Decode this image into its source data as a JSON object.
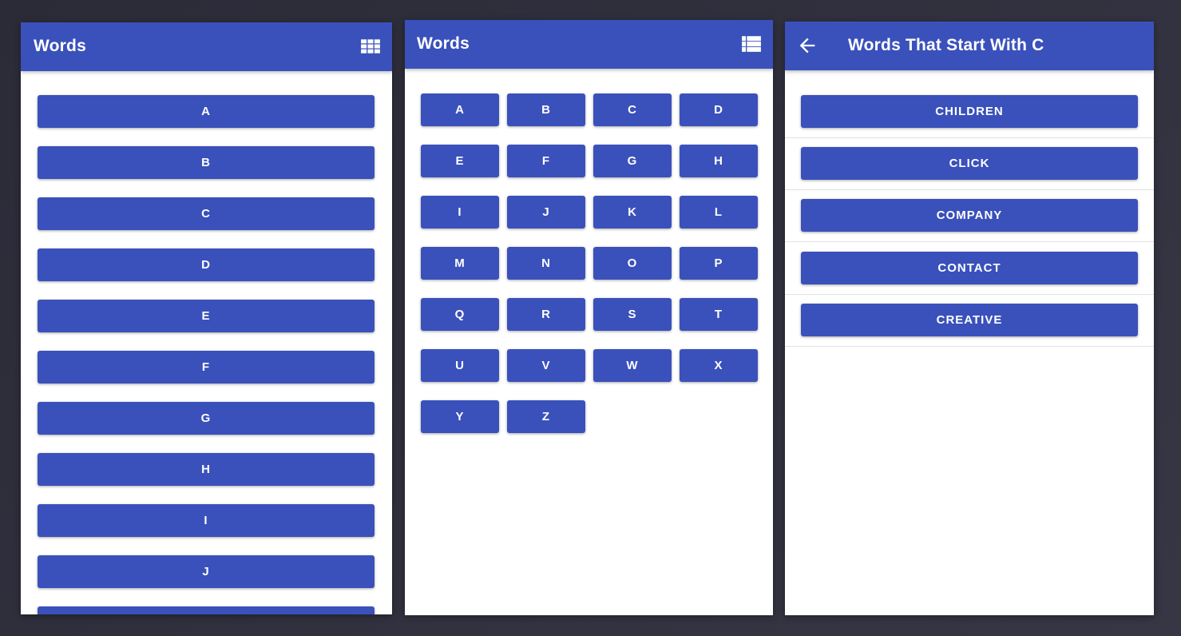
{
  "colors": {
    "primary": "#3a51bb",
    "background": "#2e2e3b",
    "surface": "#ffffff"
  },
  "list_screen": {
    "title": "Words",
    "action_icon": "grid-view-icon",
    "letters": [
      "A",
      "B",
      "C",
      "D",
      "E",
      "F",
      "G",
      "H",
      "I",
      "J",
      ""
    ]
  },
  "grid_screen": {
    "title": "Words",
    "action_icon": "list-view-icon",
    "letters": [
      "A",
      "B",
      "C",
      "D",
      "E",
      "F",
      "G",
      "H",
      "I",
      "J",
      "K",
      "L",
      "M",
      "N",
      "O",
      "P",
      "Q",
      "R",
      "S",
      "T",
      "U",
      "V",
      "W",
      "X",
      "Y",
      "Z"
    ]
  },
  "words_screen": {
    "title": "Words That Start With C",
    "back_icon": "back-arrow-icon",
    "words": [
      "CHILDREN",
      "CLICK",
      "COMPANY",
      "CONTACT",
      "CREATIVE"
    ]
  }
}
